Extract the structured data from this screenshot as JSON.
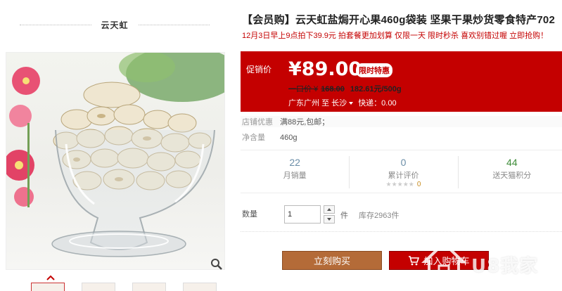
{
  "shop": {
    "name": "云天虹"
  },
  "product": {
    "title": "【会员购】云天虹盐焗开心果460g袋装 坚果干果炒货零食特产702",
    "subtitle": "12月3日早上9点拍下39.9元 拍套餐更加划算 仅限一天 限时秒杀 喜欢别错过喔 立即抢购！"
  },
  "price": {
    "promo_label": "促销价",
    "value": "¥89.00",
    "badge": "限时特惠",
    "original_label": "一口价 ¥",
    "original_value": "168.00",
    "unit_price": "182.61元/500g"
  },
  "shipping": {
    "from": "广东广州",
    "to_label": "至",
    "to": "长沙",
    "fee": "快递：0.00"
  },
  "shop_promo": {
    "label": "店铺优惠",
    "value": "满88元,包邮；"
  },
  "net_weight": {
    "label": "净含量",
    "value": "460g"
  },
  "stats": {
    "monthly_sales": {
      "value": "22",
      "label": "月销量"
    },
    "reviews": {
      "value": "0",
      "label": "累计评价",
      "stars": "★★★★★",
      "score": "0"
    },
    "points": {
      "value": "44",
      "label": "送天猫积分"
    }
  },
  "quantity": {
    "label": "数量",
    "value": "1",
    "unit": "件",
    "stock": "库存2963件"
  },
  "buttons": {
    "buy_now": "立刻购买",
    "add_to_cart": "加入购物车"
  },
  "watermark": {
    "text": "U8我家"
  },
  "colors": {
    "primary_red": "#c40000",
    "buy_brown": "#b46b38",
    "green": "#3f8d3a",
    "blue_number": "#6b8ea8"
  }
}
